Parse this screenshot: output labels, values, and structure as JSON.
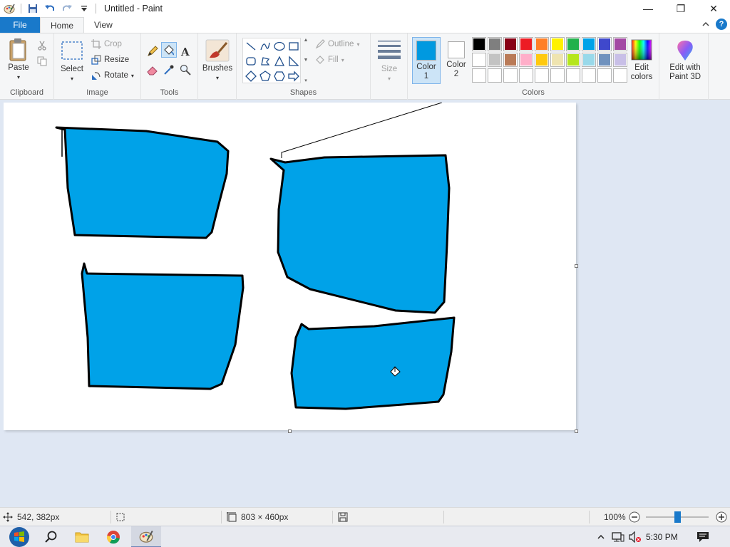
{
  "window": {
    "title": "Untitled - Paint",
    "minimize": "—",
    "maximize": "❐",
    "close": "✕"
  },
  "tabs": {
    "file": "File",
    "home": "Home",
    "view": "View"
  },
  "ribbon": {
    "clipboard": {
      "label": "Clipboard",
      "paste": "Paste"
    },
    "image": {
      "label": "Image",
      "select": "Select",
      "crop": "Crop",
      "resize": "Resize",
      "rotate": "Rotate"
    },
    "tools": {
      "label": "Tools"
    },
    "brushes": {
      "label": "Brushes"
    },
    "shapes": {
      "label": "Shapes",
      "outline": "Outline",
      "fill": "Fill"
    },
    "size": {
      "label": "Size"
    },
    "colors": {
      "label": "Colors",
      "color1_line1": "Color",
      "color1_line2": "1",
      "color2_line1": "Color",
      "color2_line2": "2",
      "edit_line1": "Edit",
      "edit_line2": "colors",
      "paint3d_line1": "Edit with",
      "paint3d_line2": "Paint 3D",
      "color1_value": "#0099e0",
      "color2_value": "#ffffff",
      "palette_row1": [
        "#000000",
        "#7f7f7f",
        "#880015",
        "#ed1c24",
        "#ff7f27",
        "#fff200",
        "#22b14c",
        "#00a2e8",
        "#3f48cc",
        "#a349a4"
      ],
      "palette_row2": [
        "#ffffff",
        "#c3c3c3",
        "#b97a57",
        "#ffaec9",
        "#ffc90e",
        "#efe4b0",
        "#b5e61d",
        "#99d9ea",
        "#7092be",
        "#c8bfe7"
      ],
      "palette_row3": [
        "#ffffff",
        "#ffffff",
        "#ffffff",
        "#ffffff",
        "#ffffff",
        "#ffffff",
        "#ffffff",
        "#ffffff",
        "#ffffff",
        "#ffffff"
      ]
    }
  },
  "canvas": {
    "fill_color": "#00a2e8",
    "stroke_color": "#000000"
  },
  "status": {
    "cursor_pos": "542, 382px",
    "image_size": "803 × 460px",
    "zoom": "100%",
    "zoom_fraction": 0.5
  },
  "taskbar": {
    "time": "5:30 PM"
  }
}
